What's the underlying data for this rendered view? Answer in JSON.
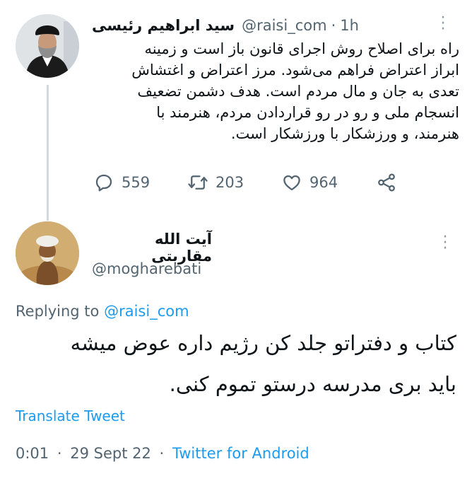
{
  "parent_tweet": {
    "display_name": "سید ابراهیم رئیسی",
    "handle": "@raisi_com",
    "separator": "·",
    "time": "1h",
    "text": "راه برای اصلاح روش اجرای قانون باز است و زمینه\nابراز اعتراض فراهم می‌شود. مرز اعتراض و اغتشاش\nتعدی به جان و مال مردم است. هدف دشمن تضعیف\nانسجام ملی و رو در رو قراردادن مردم، هنرمند با\nهنرمند، و ورزشکار با ورزشکار است.",
    "stats": {
      "replies": "559",
      "retweets": "203",
      "likes": "964"
    }
  },
  "reply_tweet": {
    "display_name": "آیت الله مقاربتی",
    "handle": "@mogharebati",
    "replying_prefix": "Replying to",
    "replying_to": "@raisi_com",
    "text": "کتاب و دفتراتو جلد کن رژیم داره عوض میشه\nباید بری مدرسه درستو تموم کنی.",
    "translate_label": "Translate Tweet",
    "time": "0:01",
    "date": "29 Sept 22",
    "source": "Twitter for Android",
    "separator": "·"
  },
  "colors": {
    "link": "#1d9bf0",
    "muted": "#536471",
    "text": "#0f1419",
    "thread_line": "#cfd9de"
  },
  "icons": [
    "more-icon",
    "reply-icon",
    "retweet-icon",
    "like-icon",
    "share-icon"
  ]
}
